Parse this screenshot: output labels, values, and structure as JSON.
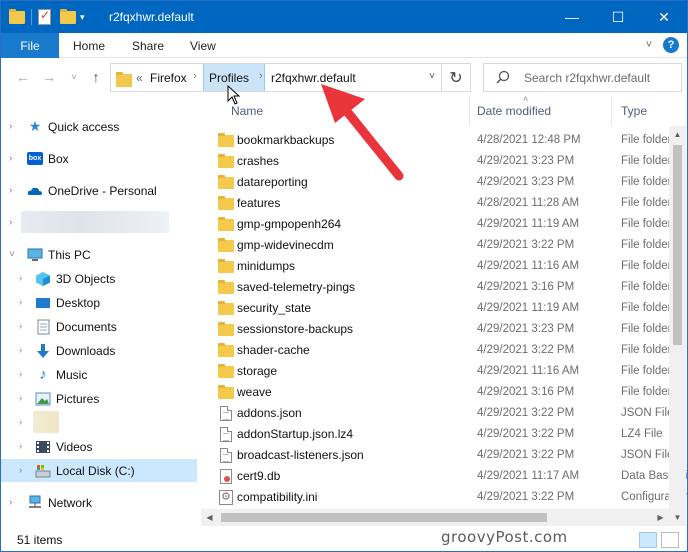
{
  "titlebar": {
    "title": "r2fqxhwr.default",
    "minimize": "—",
    "maximize": "☐",
    "close": "✕"
  },
  "ribbon": {
    "tabs": [
      "File",
      "Home",
      "Share",
      "View"
    ],
    "collapse_icon": "˅",
    "help_icon": "?"
  },
  "navbar": {
    "back": "←",
    "forward": "→",
    "recent": "˅",
    "up": "↑",
    "overflow": "«",
    "breadcrumbs": [
      "Firefox",
      "Profiles",
      "r2fqxhwr.default"
    ],
    "separator": "›",
    "dropdown": "˅",
    "refresh": "↻",
    "search_placeholder": "Search r2fqxhwr.default"
  },
  "navpane": {
    "items": [
      {
        "label": "Quick access",
        "icon": "star-icon"
      },
      {
        "label": "Box",
        "icon": "box-icon"
      },
      {
        "label": "OneDrive - Personal",
        "icon": "cloud-icon"
      },
      {
        "label": "This PC",
        "icon": "computer-icon"
      },
      {
        "label": "3D Objects",
        "icon": "cube-icon"
      },
      {
        "label": "Desktop",
        "icon": "desktop-icon"
      },
      {
        "label": "Documents",
        "icon": "documents-icon"
      },
      {
        "label": "Downloads",
        "icon": "download-icon"
      },
      {
        "label": "Music",
        "icon": "music-icon"
      },
      {
        "label": "Pictures",
        "icon": "pictures-icon"
      },
      {
        "label": "Videos",
        "icon": "videos-icon"
      },
      {
        "label": "Local Disk (C:)",
        "icon": "drive-icon"
      },
      {
        "label": "Network",
        "icon": "network-icon"
      }
    ],
    "expander": "›",
    "expander_open": "˅"
  },
  "columns": {
    "name": "Name",
    "date": "Date modified",
    "type": "Type",
    "sort_indicator": "˄"
  },
  "files": [
    {
      "name": "bookmarkbackups",
      "date": "4/28/2021 12:48 PM",
      "type": "File folder",
      "kind": "folder"
    },
    {
      "name": "crashes",
      "date": "4/29/2021 3:23 PM",
      "type": "File folder",
      "kind": "folder"
    },
    {
      "name": "datareporting",
      "date": "4/29/2021 3:23 PM",
      "type": "File folder",
      "kind": "folder"
    },
    {
      "name": "features",
      "date": "4/28/2021 11:28 AM",
      "type": "File folder",
      "kind": "folder"
    },
    {
      "name": "gmp-gmpopenh264",
      "date": "4/29/2021 11:19 AM",
      "type": "File folder",
      "kind": "folder"
    },
    {
      "name": "gmp-widevinecdm",
      "date": "4/29/2021 3:22 PM",
      "type": "File folder",
      "kind": "folder"
    },
    {
      "name": "minidumps",
      "date": "4/29/2021 11:16 AM",
      "type": "File folder",
      "kind": "folder"
    },
    {
      "name": "saved-telemetry-pings",
      "date": "4/29/2021 3:16 PM",
      "type": "File folder",
      "kind": "folder"
    },
    {
      "name": "security_state",
      "date": "4/29/2021 11:19 AM",
      "type": "File folder",
      "kind": "folder"
    },
    {
      "name": "sessionstore-backups",
      "date": "4/29/2021 3:23 PM",
      "type": "File folder",
      "kind": "folder"
    },
    {
      "name": "shader-cache",
      "date": "4/29/2021 3:22 PM",
      "type": "File folder",
      "kind": "folder"
    },
    {
      "name": "storage",
      "date": "4/29/2021 11:16 AM",
      "type": "File folder",
      "kind": "folder"
    },
    {
      "name": "weave",
      "date": "4/29/2021 3:16 PM",
      "type": "File folder",
      "kind": "folder"
    },
    {
      "name": "addons.json",
      "date": "4/29/2021 3:22 PM",
      "type": "JSON File",
      "kind": "doc"
    },
    {
      "name": "addonStartup.json.lz4",
      "date": "4/29/2021 3:22 PM",
      "type": "LZ4 File",
      "kind": "doc"
    },
    {
      "name": "broadcast-listeners.json",
      "date": "4/29/2021 3:22 PM",
      "type": "JSON File",
      "kind": "doc"
    },
    {
      "name": "cert9.db",
      "date": "4/29/2021 11:17 AM",
      "type": "Data Base File",
      "kind": "cert"
    },
    {
      "name": "compatibility.ini",
      "date": "4/29/2021 3:22 PM",
      "type": "Configuration settings",
      "kind": "cfg"
    }
  ],
  "scroll": {
    "up": "▲",
    "down": "▼",
    "left": "◀",
    "right": "▶"
  },
  "status": {
    "count": "51 items"
  },
  "watermark": "groovyPost.com",
  "colors": {
    "titlebar": "#0067c0",
    "selection": "#cce8ff",
    "arrow": "#e8343a",
    "folder": "#f5c94c"
  }
}
